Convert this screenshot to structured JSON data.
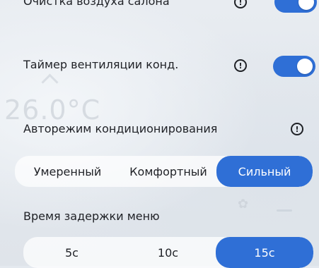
{
  "settings": {
    "air_purify": {
      "label": "Очистка воздуха салона",
      "enabled": true
    },
    "ac_vent_timer": {
      "label": "Таймер вентиляции конд.",
      "enabled": true
    },
    "ac_auto_mode": {
      "label": "Авторежим кондиционирования",
      "options": [
        "Умеренный",
        "Комфортный",
        "Сильный"
      ],
      "selected": "Сильный"
    },
    "menu_delay": {
      "label": "Время задержки меню",
      "options": [
        "5с",
        "10с",
        "15с"
      ],
      "selected": "15с"
    }
  },
  "background": {
    "temperature": "26.0°C"
  },
  "colors": {
    "accent": "#2f6fd6",
    "text": "#1f2126"
  },
  "icons": {
    "info": "info-icon",
    "fan": "fan-icon",
    "chevron_up": "chevron-up-icon"
  }
}
